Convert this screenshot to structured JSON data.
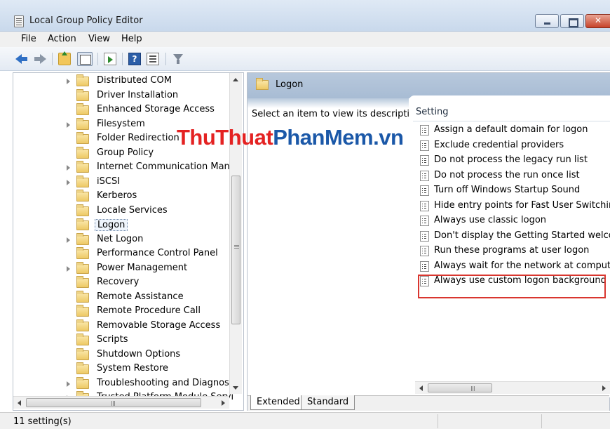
{
  "window": {
    "title": "Local Group Policy Editor"
  },
  "menu": [
    "File",
    "Action",
    "View",
    "Help"
  ],
  "tree": {
    "items": [
      {
        "label": "Distributed COM",
        "expandable": true,
        "selected": false
      },
      {
        "label": "Driver Installation",
        "expandable": false,
        "selected": false
      },
      {
        "label": "Enhanced Storage Access",
        "expandable": false,
        "selected": false
      },
      {
        "label": "Filesystem",
        "expandable": true,
        "selected": false
      },
      {
        "label": "Folder Redirection",
        "expandable": false,
        "selected": false
      },
      {
        "label": "Group Policy",
        "expandable": false,
        "selected": false
      },
      {
        "label": "Internet Communication Manag",
        "expandable": true,
        "selected": false
      },
      {
        "label": "iSCSI",
        "expandable": true,
        "selected": false
      },
      {
        "label": "Kerberos",
        "expandable": false,
        "selected": false
      },
      {
        "label": "Locale Services",
        "expandable": false,
        "selected": false
      },
      {
        "label": "Logon",
        "expandable": false,
        "selected": true
      },
      {
        "label": "Net Logon",
        "expandable": true,
        "selected": false
      },
      {
        "label": "Performance Control Panel",
        "expandable": false,
        "selected": false
      },
      {
        "label": "Power Management",
        "expandable": true,
        "selected": false
      },
      {
        "label": "Recovery",
        "expandable": false,
        "selected": false
      },
      {
        "label": "Remote Assistance",
        "expandable": false,
        "selected": false
      },
      {
        "label": "Remote Procedure Call",
        "expandable": false,
        "selected": false
      },
      {
        "label": "Removable Storage Access",
        "expandable": false,
        "selected": false
      },
      {
        "label": "Scripts",
        "expandable": false,
        "selected": false
      },
      {
        "label": "Shutdown Options",
        "expandable": false,
        "selected": false
      },
      {
        "label": "System Restore",
        "expandable": false,
        "selected": false
      },
      {
        "label": "Troubleshooting and Diagnostic",
        "expandable": true,
        "selected": false
      },
      {
        "label": "Trusted Platform Module Servi",
        "expandable": true,
        "selected": false
      }
    ]
  },
  "details": {
    "header_title": "Logon",
    "description": "Select an item to view its description.",
    "column_header": "Setting",
    "settings": [
      "Assign a default domain for logon",
      "Exclude credential providers",
      "Do not process the legacy run list",
      "Do not process the run once list",
      "Turn off Windows Startup Sound",
      "Hide entry points for Fast User Switching",
      "Always use classic logon",
      "Don't display the Getting Started welcome",
      "Run these programs at user logon",
      "Always wait for the network at computer s",
      "Always use custom logon background"
    ],
    "highlighted_setting_index": 10,
    "tabs": [
      "Extended",
      "Standard"
    ],
    "active_tab": "Extended"
  },
  "status": {
    "text": "11 setting(s)"
  },
  "watermark": {
    "part1": "ThuThuat",
    "part2": "PhanMem",
    "part3": ".vn"
  },
  "colors": {
    "highlight_border": "#d9362f",
    "watermark_red": "#e42222",
    "watermark_blue": "#1b58a8"
  }
}
